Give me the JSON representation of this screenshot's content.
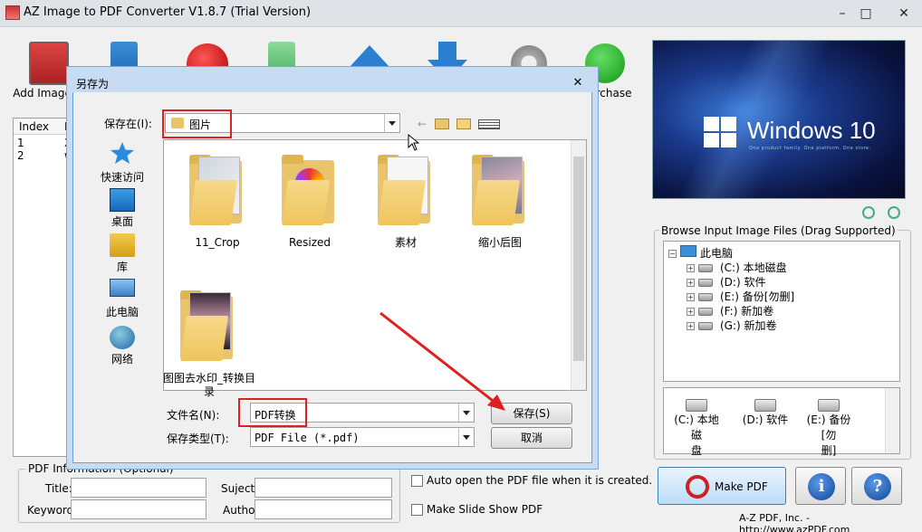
{
  "app": {
    "title": "AZ Image to PDF Converter V1.8.7 (Trial Version)",
    "minimize": "–",
    "maximize": "□",
    "close": "✕"
  },
  "toolbar": {
    "add_image_label": "Add Image(s",
    "purchase_label": "urchase"
  },
  "image_list": {
    "columns": [
      "Index",
      "F"
    ],
    "rows": [
      {
        "index": "1",
        "file": "X"
      },
      {
        "index": "2",
        "file": "w"
      }
    ]
  },
  "pdf_info": {
    "legend": "PDF Information (Optional)",
    "title_label": "Title:",
    "suject_label": "Suject:",
    "keyword_label": "Keyword:",
    "author_label": "Author"
  },
  "options": {
    "auto_open_label": "Auto open the PDF file when it is created.",
    "slideshow_label": "Make Slide Show PDF"
  },
  "preview": {
    "windows_text": "Windows 10",
    "windows_sub": "One product family. One platform. One store."
  },
  "browse": {
    "legend": "Browse Input Image Files (Drag Supported)",
    "root": "此电脑",
    "drives": [
      "(C:) 本地磁盘",
      "(D:) 软件",
      "(E:) 备份[勿删]",
      "(F:) 新加卷",
      "(G:) 新加卷"
    ],
    "drive_icons": [
      {
        "line1": "(C:) 本地磁",
        "line2": "盘"
      },
      {
        "line1": "(D:) 软件",
        "line2": ""
      },
      {
        "line1": "(E:) 备份[勿",
        "line2": "删]"
      }
    ]
  },
  "actions": {
    "make_pdf_label": "Make PDF",
    "info_glyph": "i",
    "help_glyph": "?",
    "footer": "A-Z PDF, Inc. - http://www.azPDF.com"
  },
  "dialog": {
    "title": "另存为",
    "close": "✕",
    "save_in_label": "保存在(I):",
    "save_in_value": "图片",
    "places": [
      "快速访问",
      "桌面",
      "库",
      "此电脑",
      "网络"
    ],
    "folders": [
      {
        "name": "11_Crop"
      },
      {
        "name": "Resized"
      },
      {
        "name": "素材"
      },
      {
        "name": "缩小后图"
      },
      {
        "name": "图图去水印_转换目录"
      }
    ],
    "filename_label": "文件名(N):",
    "filename_value": "PDF转换",
    "filetype_label": "保存类型(T):",
    "filetype_value": "PDF File (*.pdf)",
    "save_button": "保存(S)",
    "cancel_button": "取消"
  },
  "colors": {
    "highlight": "#e02020",
    "dialog_frame": "#c7dcf3",
    "folder": "#e9c46a"
  }
}
